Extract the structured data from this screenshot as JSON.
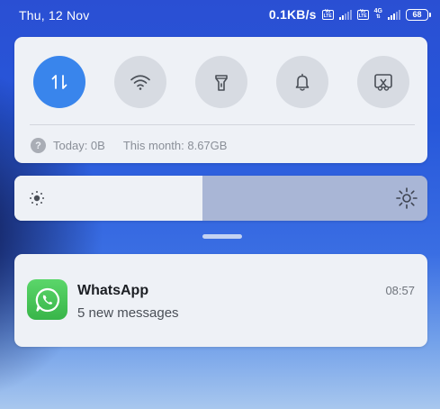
{
  "status_bar": {
    "date": "Thu, 12 Nov",
    "net_speed": "0.1KB/s",
    "sim1_tag": [
      "Vo",
      "LTE"
    ],
    "sim2_tag": [
      "Vo",
      "LTE"
    ],
    "network_type": "4G",
    "battery": "68",
    "icons": [
      "volte-icon",
      "signal-icon",
      "volte-icon",
      "4g-icon",
      "signal-icon",
      "battery-icon"
    ]
  },
  "quick_settings": {
    "toggles": [
      {
        "id": "mobile-data",
        "icon": "mobile-data-arrows-icon",
        "active": true
      },
      {
        "id": "wifi",
        "icon": "wifi-icon",
        "active": false
      },
      {
        "id": "flashlight",
        "icon": "flashlight-icon",
        "active": false
      },
      {
        "id": "sound",
        "icon": "bell-icon",
        "active": false
      },
      {
        "id": "screenshot",
        "icon": "screenshot-scissors-icon",
        "active": false
      }
    ],
    "data_usage": {
      "today": "Today: 0B",
      "month": "This month: 8.67GB"
    },
    "active_color": "#3985ec"
  },
  "brightness": {
    "level": 0.455,
    "icons": [
      "sun-low-icon",
      "sun-high-icon"
    ]
  },
  "notification": {
    "app_name": "WhatsApp",
    "message": "5 new messages",
    "time": "08:57",
    "icon": "whatsapp-icon",
    "brand_color": "#4cc75a"
  }
}
